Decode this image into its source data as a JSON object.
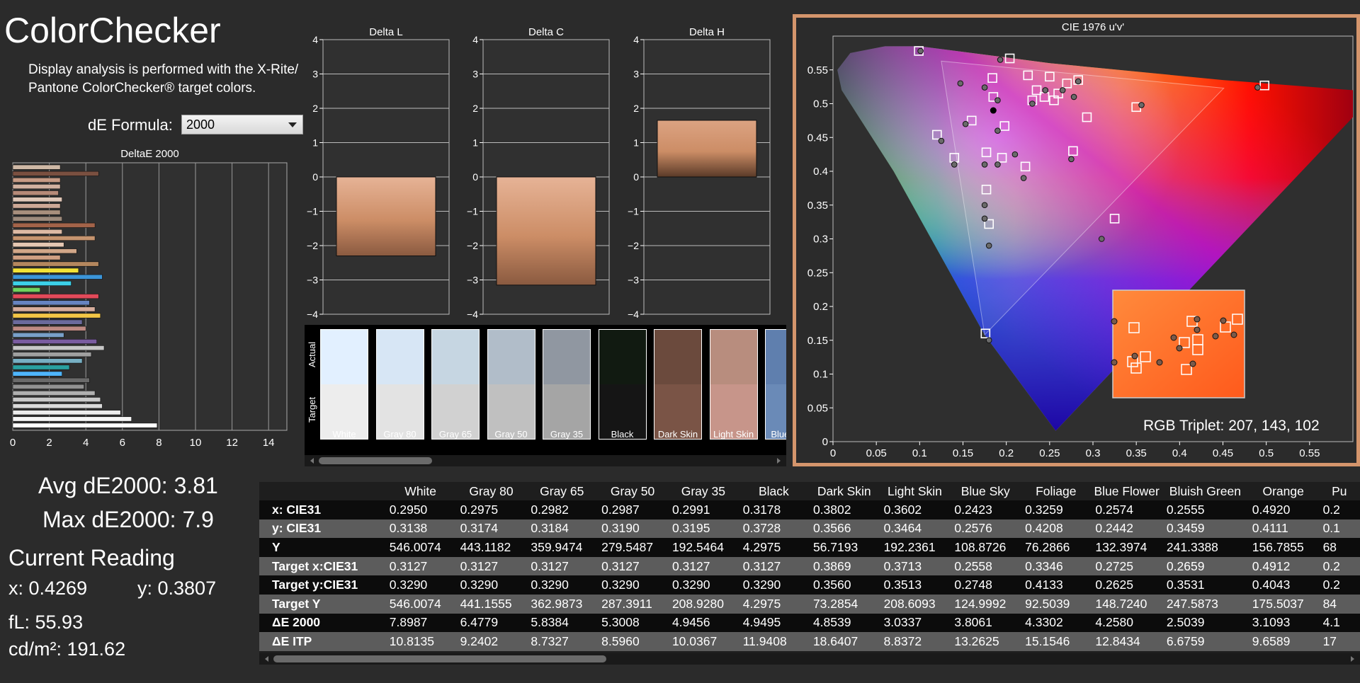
{
  "app": {
    "title": "ColorChecker",
    "description": "Display analysis is performed with the X-Rite/ Pantone ColorChecker® target colors.",
    "de_formula_label": "dE Formula:",
    "de_formula_value": "2000"
  },
  "stats": {
    "avg": "Avg dE2000: 3.81",
    "max": "Max dE2000: 7.9",
    "current_reading": "Current Reading",
    "x": "x: 0.4269",
    "y": "y: 0.3807",
    "fl": "fL: 55.93",
    "cdm2": "cd/m²: 191.62"
  },
  "rgb_triplet": "RGB Triplet: 207, 143, 102",
  "colors": {
    "background": "#2b2b2b",
    "frame_accent": "#d4956c",
    "bar_swatch": "#cf8f66"
  },
  "chart_data": [
    {
      "type": "bar",
      "orientation": "horizontal",
      "title": "DeltaE 2000",
      "xlim": [
        0,
        15
      ],
      "xticks": [
        0,
        2,
        4,
        6,
        8,
        10,
        12,
        14
      ],
      "values": [
        2.6,
        4.7,
        2.6,
        2.6,
        2.5,
        2.7,
        2.6,
        2.6,
        2.7,
        4.5,
        2.7,
        4.5,
        2.8,
        3.5,
        2.6,
        4.7,
        3.6,
        4.9,
        3.2,
        1.5,
        4.7,
        4.2,
        4.5,
        4.8,
        3.8,
        4.0,
        2.8,
        4.6,
        5.0,
        4.3,
        3.8,
        3.1,
        2.7,
        4.2,
        3.9,
        4.5,
        4.8,
        4.9,
        5.9,
        6.5,
        7.9
      ],
      "colors": [
        "#cfb9a6",
        "#7a5040",
        "#c79b85",
        "#d1b1a0",
        "#b68a78",
        "#e0c7b8",
        "#cda896",
        "#a88f7d",
        "#9d8a7c",
        "#a36349",
        "#dcb9a4",
        "#c6946f",
        "#e6c8b3",
        "#d1a688",
        "#cf9f82",
        "#b4875e",
        "#f2e237",
        "#3b95d9",
        "#3cd1e9",
        "#6fd35d",
        "#e24a5a",
        "#6684c1",
        "#d6ad9c",
        "#f3c646",
        "#6b6a9c",
        "#be8a83",
        "#79a0c9",
        "#7a5ca0",
        "#c7c7c7",
        "#a0a0a0",
        "#78b0c4",
        "#2aa0a0",
        "#4fb6ff",
        "#6a6a6a",
        "#919191",
        "#b0b0b0",
        "#c9c9c9",
        "#dadada",
        "#ececec",
        "#f6f6f6",
        "#ffffff"
      ]
    },
    {
      "type": "bar",
      "title": "Delta L",
      "ylim": [
        -4,
        4
      ],
      "yticks": [
        4,
        3,
        2,
        1,
        0,
        -1,
        -2,
        -3,
        -4
      ],
      "values": [
        -2.3
      ]
    },
    {
      "type": "bar",
      "title": "Delta C",
      "ylim": [
        -4,
        4
      ],
      "yticks": [
        4,
        3,
        2,
        1,
        0,
        -1,
        -2,
        -3,
        -4
      ],
      "values": [
        -3.15
      ]
    },
    {
      "type": "bar",
      "title": "Delta H",
      "ylim": [
        -4,
        4
      ],
      "yticks": [
        4,
        3,
        2,
        1,
        0,
        -1,
        -2,
        -3,
        -4
      ],
      "values": [
        1.65
      ]
    },
    {
      "type": "scatter",
      "title": "CIE 1976 u'v'",
      "xlim": [
        0,
        0.6
      ],
      "ylim": [
        0,
        0.6
      ],
      "xticks": [
        0,
        0.05,
        0.1,
        0.15,
        0.2,
        0.25,
        0.3,
        0.35,
        0.4,
        0.45,
        0.5,
        0.55
      ],
      "yticks": [
        0,
        0.05,
        0.1,
        0.15,
        0.2,
        0.25,
        0.3,
        0.35,
        0.4,
        0.45,
        0.5,
        0.55
      ],
      "targets": [
        [
          0.099,
          0.578
        ],
        [
          0.204,
          0.567
        ],
        [
          0.184,
          0.538
        ],
        [
          0.225,
          0.542
        ],
        [
          0.25,
          0.54
        ],
        [
          0.27,
          0.53
        ],
        [
          0.283,
          0.535
        ],
        [
          0.235,
          0.52
        ],
        [
          0.26,
          0.515
        ],
        [
          0.244,
          0.51
        ],
        [
          0.23,
          0.505
        ],
        [
          0.255,
          0.505
        ],
        [
          0.185,
          0.51
        ],
        [
          0.293,
          0.48
        ],
        [
          0.35,
          0.495
        ],
        [
          0.498,
          0.527
        ],
        [
          0.16,
          0.475
        ],
        [
          0.198,
          0.467
        ],
        [
          0.12,
          0.454
        ],
        [
          0.14,
          0.42
        ],
        [
          0.177,
          0.428
        ],
        [
          0.195,
          0.42
        ],
        [
          0.222,
          0.407
        ],
        [
          0.277,
          0.43
        ],
        [
          0.177,
          0.373
        ],
        [
          0.18,
          0.322
        ],
        [
          0.325,
          0.33
        ],
        [
          0.176,
          0.16
        ]
      ],
      "actuals": [
        [
          0.101,
          0.578
        ],
        [
          0.193,
          0.565
        ],
        [
          0.175,
          0.524
        ],
        [
          0.147,
          0.53
        ],
        [
          0.19,
          0.505
        ],
        [
          0.185,
          0.49
        ],
        [
          0.23,
          0.5
        ],
        [
          0.245,
          0.52
        ],
        [
          0.265,
          0.52
        ],
        [
          0.278,
          0.51
        ],
        [
          0.283,
          0.533
        ],
        [
          0.356,
          0.498
        ],
        [
          0.49,
          0.524
        ],
        [
          0.153,
          0.47
        ],
        [
          0.125,
          0.445
        ],
        [
          0.19,
          0.46
        ],
        [
          0.175,
          0.41
        ],
        [
          0.19,
          0.41
        ],
        [
          0.21,
          0.425
        ],
        [
          0.22,
          0.39
        ],
        [
          0.275,
          0.418
        ],
        [
          0.14,
          0.41
        ],
        [
          0.175,
          0.35
        ],
        [
          0.175,
          0.33
        ],
        [
          0.18,
          0.29
        ],
        [
          0.31,
          0.3
        ],
        [
          0.18,
          0.15
        ]
      ],
      "current": [
        0.185,
        0.49
      ]
    }
  ],
  "swatches": {
    "labels": {
      "actual": "Actual",
      "target": "Target"
    },
    "items": [
      {
        "name": "White",
        "actual": "#e2f0ff",
        "target": "#ededed"
      },
      {
        "name": "Gray 80",
        "actual": "#d7e6f5",
        "target": "#e3e3e3"
      },
      {
        "name": "Gray 65",
        "actual": "#c6d6e2",
        "target": "#d1d1d1"
      },
      {
        "name": "Gray 50",
        "actual": "#b1bdc9",
        "target": "#c0c0c0"
      },
      {
        "name": "Gray 35",
        "actual": "#9097a1",
        "target": "#a5a5a5"
      },
      {
        "name": "Black",
        "actual": "#111a11",
        "target": "#151515"
      },
      {
        "name": "Dark Skin",
        "actual": "#6b4a3d",
        "target": "#7a5446"
      },
      {
        "name": "Light Skin",
        "actual": "#b88d7e",
        "target": "#c7958a"
      },
      {
        "name": "Blue Sky",
        "actual": "#5f7fae",
        "target": "#6a8ab7"
      }
    ]
  },
  "table": {
    "columns": [
      "White",
      "Gray 80",
      "Gray 65",
      "Gray 50",
      "Gray 35",
      "Black",
      "Dark Skin",
      "Light Skin",
      "Blue Sky",
      "Foliage",
      "Blue Flower",
      "Bluish Green",
      "Orange",
      "Pu"
    ],
    "rows": [
      {
        "label": "x: CIE31",
        "values": [
          "0.2950",
          "0.2975",
          "0.2982",
          "0.2987",
          "0.2991",
          "0.3178",
          "0.3802",
          "0.3602",
          "0.2423",
          "0.3259",
          "0.2574",
          "0.2555",
          "0.4920",
          "0.2"
        ]
      },
      {
        "label": "y: CIE31",
        "values": [
          "0.3138",
          "0.3174",
          "0.3184",
          "0.3190",
          "0.3195",
          "0.3728",
          "0.3566",
          "0.3464",
          "0.2576",
          "0.4208",
          "0.2442",
          "0.3459",
          "0.4111",
          "0.1"
        ]
      },
      {
        "label": "Y",
        "values": [
          "546.0074",
          "443.1182",
          "359.9474",
          "279.5487",
          "192.5464",
          "4.2975",
          "56.7193",
          "192.2361",
          "108.8726",
          "76.2866",
          "132.3974",
          "241.3388",
          "156.7855",
          "68"
        ]
      },
      {
        "label": "Target x:CIE31",
        "values": [
          "0.3127",
          "0.3127",
          "0.3127",
          "0.3127",
          "0.3127",
          "0.3127",
          "0.3869",
          "0.3713",
          "0.2558",
          "0.3346",
          "0.2725",
          "0.2659",
          "0.4912",
          "0.2"
        ]
      },
      {
        "label": "Target y:CIE31",
        "values": [
          "0.3290",
          "0.3290",
          "0.3290",
          "0.3290",
          "0.3290",
          "0.3290",
          "0.3560",
          "0.3513",
          "0.2748",
          "0.4133",
          "0.2625",
          "0.3531",
          "0.4043",
          "0.2"
        ]
      },
      {
        "label": "Target Y",
        "values": [
          "546.0074",
          "441.1555",
          "362.9873",
          "287.3911",
          "208.9280",
          "4.2975",
          "73.2854",
          "208.6093",
          "124.9992",
          "92.5039",
          "148.7240",
          "247.5873",
          "175.5037",
          "84"
        ]
      },
      {
        "label": "ΔE 2000",
        "values": [
          "7.8987",
          "6.4779",
          "5.8384",
          "5.3008",
          "4.9456",
          "4.9495",
          "4.8539",
          "3.0337",
          "3.8061",
          "4.3302",
          "4.2580",
          "2.5039",
          "3.1093",
          "4.1"
        ]
      },
      {
        "label": "ΔE ITP",
        "values": [
          "10.8135",
          "9.2402",
          "8.7327",
          "8.5960",
          "10.0367",
          "11.9408",
          "18.6407",
          "8.8372",
          "13.2625",
          "15.1546",
          "12.8434",
          "6.6759",
          "9.6589",
          "17"
        ]
      }
    ]
  }
}
